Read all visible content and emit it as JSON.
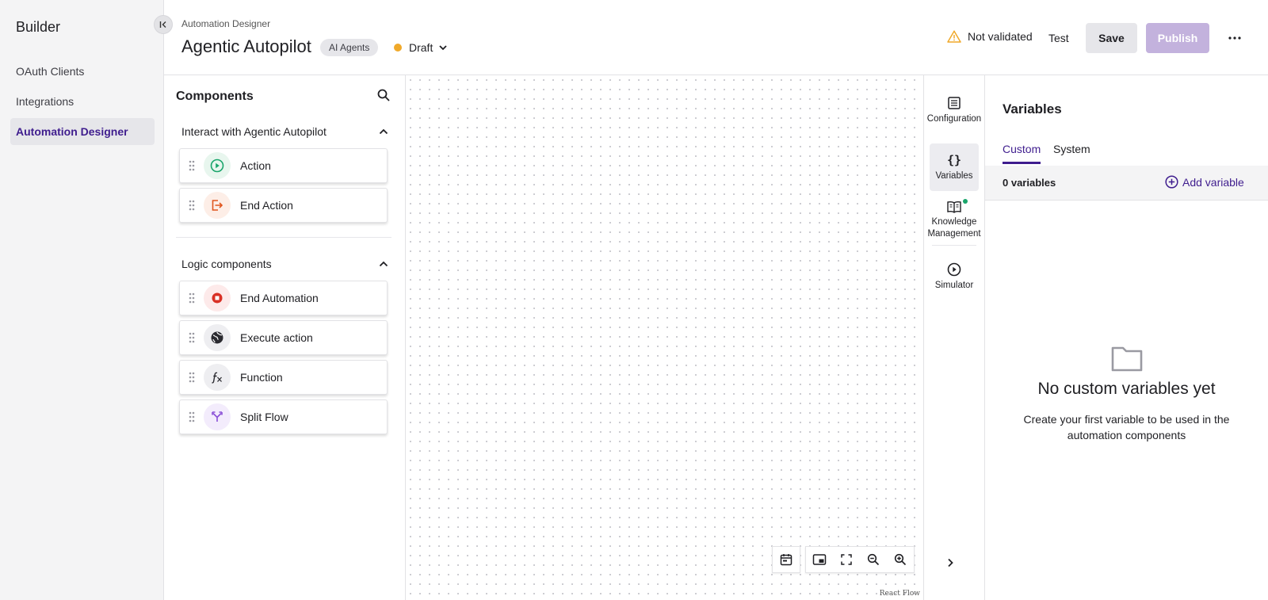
{
  "sidebar": {
    "brand": "Builder",
    "items": [
      {
        "label": "OAuth Clients"
      },
      {
        "label": "Integrations"
      },
      {
        "label": "Automation Designer",
        "active": true
      }
    ]
  },
  "header": {
    "breadcrumb": "Automation Designer",
    "title": "Agentic Autopilot",
    "chip": "AI Agents",
    "status": "Draft",
    "validation": "Not validated",
    "test_label": "Test",
    "save_label": "Save",
    "publish_label": "Publish"
  },
  "components": {
    "title": "Components",
    "sections": [
      {
        "title": "Interact with Agentic Autopilot",
        "items": [
          {
            "label": "Action",
            "icon": "play-circle-icon"
          },
          {
            "label": "End Action",
            "icon": "exit-icon"
          }
        ]
      },
      {
        "title": "Logic components",
        "items": [
          {
            "label": "End Automation",
            "icon": "stop-icon"
          },
          {
            "label": "Execute action",
            "icon": "globe-icon"
          },
          {
            "label": "Function",
            "icon": "function-icon"
          },
          {
            "label": "Split Flow",
            "icon": "split-icon"
          }
        ]
      }
    ]
  },
  "canvas": {
    "attribution": "React Flow"
  },
  "rail": {
    "items": [
      {
        "label": "Configuration"
      },
      {
        "label": "Variables",
        "active": true
      },
      {
        "label_line1": "Knowledge",
        "label_line2": "Management"
      },
      {
        "label": "Simulator"
      }
    ]
  },
  "variables": {
    "title": "Variables",
    "tabs": [
      {
        "label": "Custom",
        "active": true
      },
      {
        "label": "System"
      }
    ],
    "count": "0 variables",
    "add_label": "Add variable",
    "empty_title": "No custom variables yet",
    "empty_desc": "Create your first variable to be used in the automation components"
  },
  "colors": {
    "accent": "#3f1d8e",
    "publish_disabled": "#c3b2dd",
    "draft_dot": "#f0a92a",
    "warning": "#f0a92a",
    "action_icon": "#1aa56b",
    "end_action_icon": "#e0561f",
    "end_automation_icon": "#d93025",
    "split_icon": "#8a4fd6"
  }
}
